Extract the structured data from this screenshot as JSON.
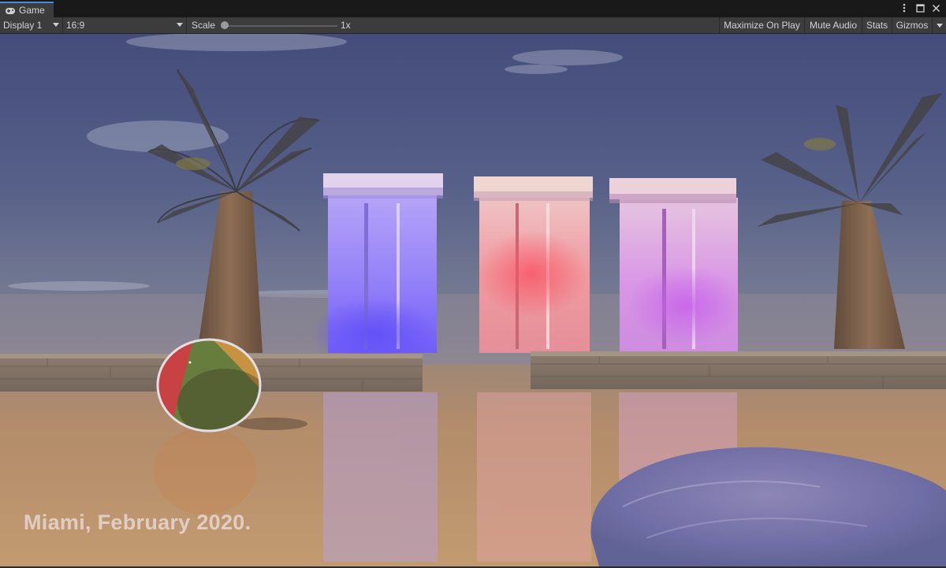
{
  "tab": {
    "label": "Game",
    "icon": "gamepad-icon"
  },
  "window_controls": {
    "menu_icon": "kebab-menu-icon",
    "maximize_icon": "maximize-icon",
    "close_icon": "close-icon"
  },
  "toolbar": {
    "display_label": "Display 1",
    "aspect_label": "16:9",
    "scale_label": "Scale",
    "scale_value": "1x",
    "maximize_on_play": "Maximize On Play",
    "mute_audio": "Mute Audio",
    "stats": "Stats",
    "gizmos": "Gizmos"
  },
  "scene": {
    "caption": "Miami, February 2020.",
    "objects": [
      "palm-tree-left",
      "palm-tree-right",
      "pillar-blue",
      "pillar-red",
      "pillar-violet",
      "stone-wall-left",
      "stone-wall-right",
      "beach-ball",
      "water-pool"
    ]
  },
  "colors": {
    "accent": "#4a8be0",
    "sky_top": "#3b4a7c",
    "sky_horizon": "#5a6a8a",
    "ground": "#b18a63",
    "pillar_blue_glow": "#6f5cff",
    "pillar_red_glow": "#ff6a7a",
    "pillar_violet_glow": "#d070f0"
  }
}
